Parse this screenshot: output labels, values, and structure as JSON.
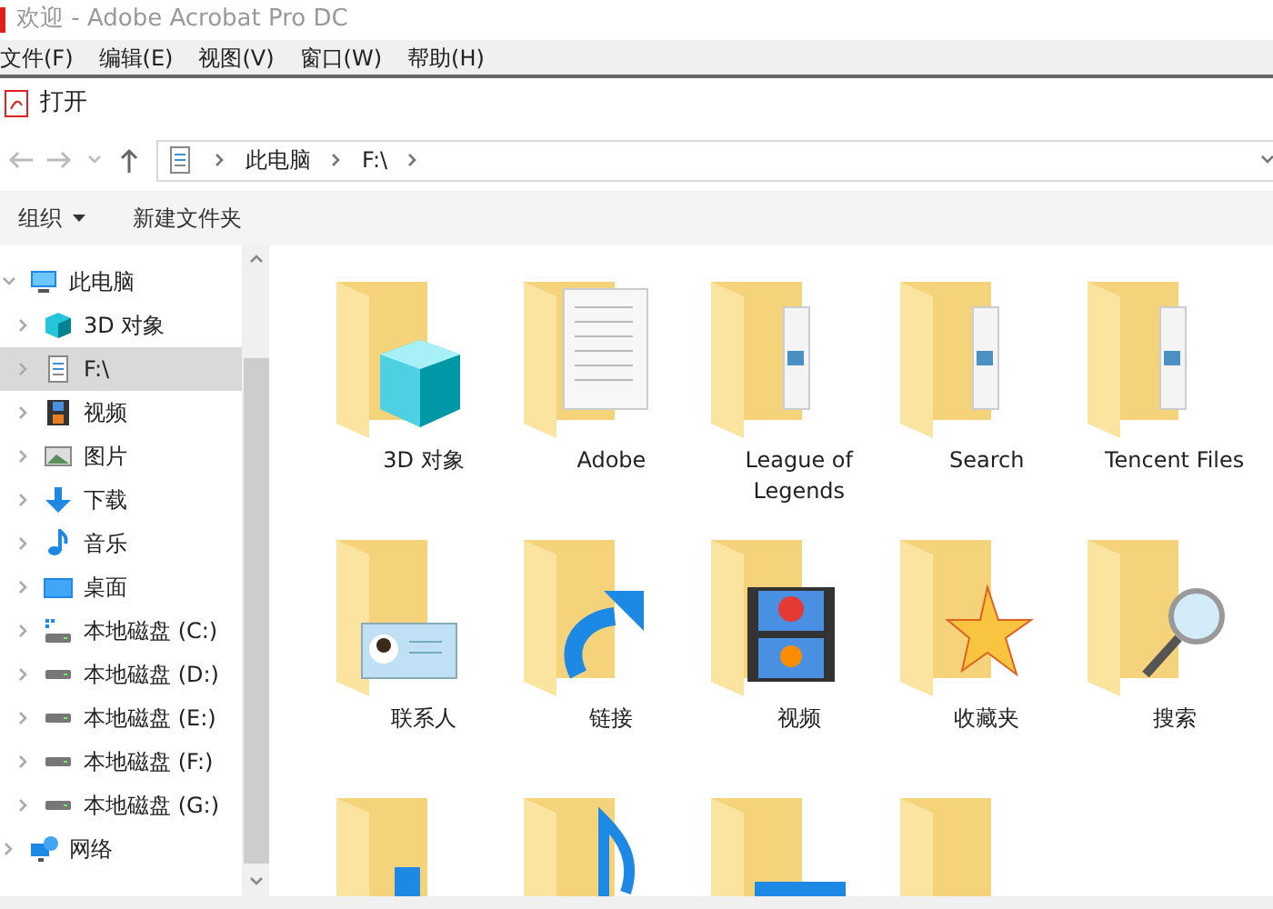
{
  "window": {
    "title": "欢迎 - Adobe Acrobat Pro DC"
  },
  "menu": [
    "文件(F)",
    "编辑(E)",
    "视图(V)",
    "窗口(W)",
    "帮助(H)"
  ],
  "dialog": {
    "title": "打开"
  },
  "address": {
    "crumbs": [
      "此电脑",
      "F:\\"
    ]
  },
  "toolbar": {
    "organize": "组织",
    "new_folder": "新建文件夹"
  },
  "nav": [
    {
      "label": "此电脑",
      "kind": "pc",
      "expanded": true,
      "selected": false,
      "children": [
        {
          "label": "3D 对象",
          "kind": "cube",
          "expanded": false,
          "selected": false
        },
        {
          "label": "F:\\",
          "kind": "doc",
          "expanded": false,
          "selected": true
        },
        {
          "label": "视频",
          "kind": "video",
          "expanded": false,
          "selected": false
        },
        {
          "label": "图片",
          "kind": "picture",
          "expanded": false,
          "selected": false
        },
        {
          "label": "下载",
          "kind": "download",
          "expanded": false,
          "selected": false
        },
        {
          "label": "音乐",
          "kind": "music",
          "expanded": false,
          "selected": false
        },
        {
          "label": "桌面",
          "kind": "desktop",
          "expanded": false,
          "selected": false
        },
        {
          "label": "本地磁盘 (C:)",
          "kind": "sysdrive",
          "expanded": false,
          "selected": false
        },
        {
          "label": "本地磁盘 (D:)",
          "kind": "drive",
          "expanded": false,
          "selected": false
        },
        {
          "label": "本地磁盘 (E:)",
          "kind": "drive",
          "expanded": false,
          "selected": false
        },
        {
          "label": "本地磁盘 (F:)",
          "kind": "drive",
          "expanded": false,
          "selected": false
        },
        {
          "label": "本地磁盘 (G:)",
          "kind": "drive",
          "expanded": false,
          "selected": false
        }
      ]
    },
    {
      "label": "网络",
      "kind": "network",
      "expanded": false,
      "selected": false
    }
  ],
  "files": [
    {
      "label": "3D 对象",
      "kind": "cube"
    },
    {
      "label": "Adobe",
      "kind": "doc"
    },
    {
      "label": "League of Legends",
      "kind": "files"
    },
    {
      "label": "Search",
      "kind": "files"
    },
    {
      "label": "Tencent Files",
      "kind": "files"
    },
    {
      "label": "联系人",
      "kind": "contact"
    },
    {
      "label": "链接",
      "kind": "link"
    },
    {
      "label": "视频",
      "kind": "video"
    },
    {
      "label": "收藏夹",
      "kind": "star"
    },
    {
      "label": "搜索",
      "kind": "search"
    },
    {
      "kind": "download"
    },
    {
      "kind": "music"
    },
    {
      "kind": "desktop"
    },
    {
      "kind": "plain"
    }
  ]
}
